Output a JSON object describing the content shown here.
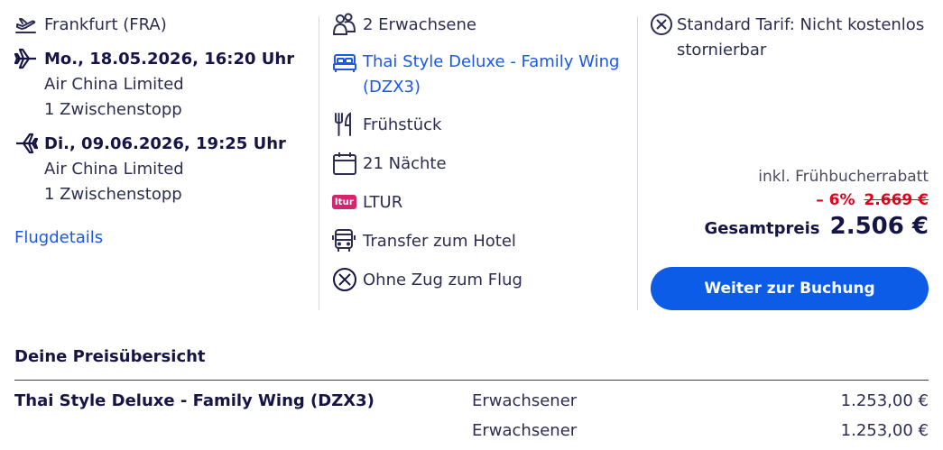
{
  "flight": {
    "origin": "Frankfurt (FRA)",
    "outbound_date": "Mo., 18.05.2026, 16:20 Uhr",
    "outbound_airline": "Air China Limited",
    "outbound_stops": "1 Zwischenstopp",
    "return_date": "Di., 09.06.2026, 19:25 Uhr",
    "return_airline": "Air China Limited",
    "return_stops": "1 Zwischenstopp",
    "details_link": "Flugdetails"
  },
  "hotel": {
    "travelers": "2 Erwachsene",
    "room_line1": "Thai Style Deluxe - Family Wing",
    "room_line2": "(DZX3)",
    "board": "Frühstück",
    "nights": "21 Nächte",
    "operator_badge": "ltur",
    "operator": "LTUR",
    "transfer": "Transfer zum Hotel",
    "train": "Ohne Zug zum Flug"
  },
  "tariff": {
    "line1": "Standard Tarif: Nicht kostenlos",
    "line2": "stornierbar"
  },
  "price": {
    "inkl_label": "inkl. Frühbucherrabatt",
    "discount_pct": "– 6%",
    "old_price": "2.669 €",
    "total_label": "Gesamtpreis",
    "total_value": "2.506 €",
    "book_button": "Weiter zur Buchung"
  },
  "overview": {
    "title": "Deine Preisübersicht",
    "rows": [
      {
        "name": "Thai Style Deluxe - Family Wing (DZX3)",
        "type": "Erwachsener",
        "amount": "1.253,00 €"
      },
      {
        "name": "",
        "type": "Erwachsener",
        "amount": "1.253,00 €"
      }
    ]
  },
  "colors": {
    "text": "#22244a",
    "link": "#1b57e8",
    "button": "#0d5ce8",
    "discount": "#e2001a",
    "ltur_brand": "#d6246e"
  },
  "icons": [
    "departure-icon",
    "plane-right-icon",
    "plane-left-icon",
    "travelers-icon",
    "bed-icon",
    "cutlery-icon",
    "calendar-icon",
    "ltur-logo",
    "bus-icon",
    "no-train-icon",
    "cancel-tariff-icon"
  ]
}
